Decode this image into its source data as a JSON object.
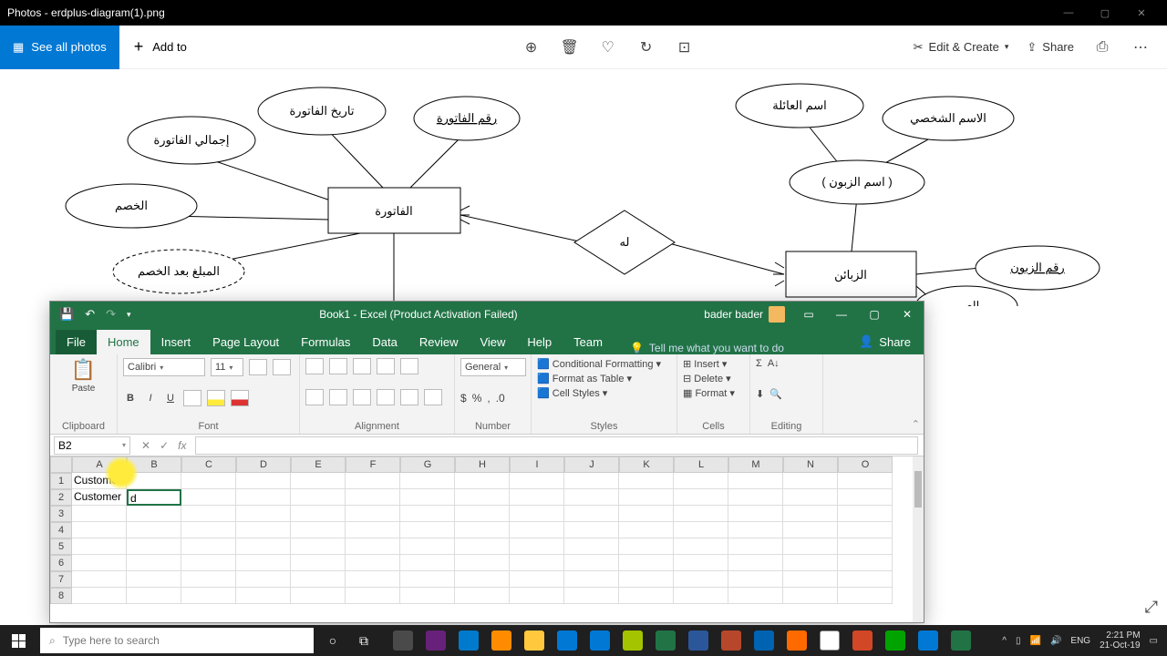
{
  "photos": {
    "title": "Photos - erdplus-diagram(1).png",
    "see_all": "See all photos",
    "add_to": "Add to",
    "edit_create": "Edit & Create",
    "share": "Share"
  },
  "erd": {
    "invoice_date": "تاريخ الفاتورة",
    "invoice_no": "رقم الفاتورة",
    "invoice_total": "إجمالي الفاتورة",
    "discount": "الخصم",
    "after_discount": "المبلغ بعد الخصم",
    "invoice": "الفاتورة",
    "has": "له",
    "customers": "الزبائن",
    "family_name": "اسم العائلة",
    "personal_name": "الاسم الشخصي",
    "customer_name": "( اسم الزبون )",
    "customer_no": "رقم الزبون",
    "age": "العمر"
  },
  "excel": {
    "title": "Book1  -  Excel (Product Activation Failed)",
    "user": "bader bader",
    "tabs": {
      "file": "File",
      "home": "Home",
      "insert": "Insert",
      "page": "Page Layout",
      "formulas": "Formulas",
      "data": "Data",
      "review": "Review",
      "view": "View",
      "help": "Help",
      "team": "Team"
    },
    "tellme": "Tell me what you want to do",
    "share": "Share",
    "font_name": "Calibri",
    "font_size": "11",
    "number_format": "General",
    "cond_fmt": "Conditional Formatting",
    "fmt_table": "Format as Table",
    "cell_styles": "Cell Styles",
    "insert_btn": "Insert",
    "delete_btn": "Delete",
    "format_btn": "Format",
    "groups": {
      "clipboard": "Clipboard",
      "font": "Font",
      "alignment": "Alignment",
      "number": "Number",
      "styles": "Styles",
      "cells": "Cells",
      "editing": "Editing"
    },
    "paste": "Paste",
    "namebox": "B2",
    "cols": [
      "A",
      "B",
      "C",
      "D",
      "E",
      "F",
      "G",
      "H",
      "I",
      "J",
      "K",
      "L",
      "M",
      "N",
      "O"
    ],
    "rows": [
      "1",
      "2",
      "3",
      "4",
      "5",
      "6",
      "7",
      "8"
    ],
    "a1": "Customer",
    "a2": "Customer",
    "b2": "d"
  },
  "taskbar": {
    "search_placeholder": "Type here to search",
    "lang": "ENG",
    "time": "2:21 PM",
    "date": "21-Oct-19"
  }
}
